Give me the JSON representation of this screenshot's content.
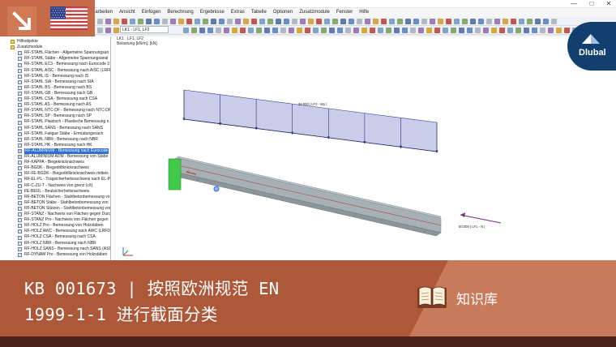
{
  "menu": {
    "items": [
      "Bearbeiten",
      "Ansicht",
      "Einfügen",
      "Berechnung",
      "Ergebnisse",
      "Extras",
      "Tabelle",
      "Optionen",
      "Zusatzmodule",
      "Fenster",
      "Hilfe"
    ]
  },
  "toolbar": {
    "loadcase_combo": "LK1 - LF1, LF2"
  },
  "workspace": {
    "label_case": "LK1 : LF1, LF2",
    "label_load": "Belastung [kN/m], [kN]",
    "load_label_top": "36.000 | LF2 - Wy |",
    "load_label_side": "50.000 | LF1 - N |"
  },
  "navigator": {
    "items": [
      {
        "label": "Hilfsobjekte",
        "icon": "folder-icon",
        "indent": 0
      },
      {
        "label": "Zusatzmodule",
        "icon": "folder-icon",
        "indent": 0
      },
      {
        "label": "RF-STAHL Flächen - Allgemeine Spannungsan",
        "icon": "module-icon",
        "indent": 1
      },
      {
        "label": "RF-STAHL Stäbe - Allgemeine Spannungsanal",
        "icon": "module-icon",
        "indent": 1
      },
      {
        "label": "RF-STAHL EC3 - Bemessung nach Eurocode 3",
        "icon": "module-icon",
        "indent": 1
      },
      {
        "label": "RF-STAHL AISC - Bemessung nach AISC (LRFD",
        "icon": "module-icon",
        "indent": 1
      },
      {
        "label": "RF-STAHL IS - Bemessung nach IS",
        "icon": "module-icon",
        "indent": 1
      },
      {
        "label": "RF-STAHL SIA - Bemessung nach SIA",
        "icon": "module-icon",
        "indent": 1
      },
      {
        "label": "RF-STAHL BS - Bemessung nach BS",
        "icon": "module-icon",
        "indent": 1
      },
      {
        "label": "RF-STAHL GB - Bemessung nach GB",
        "icon": "module-icon",
        "indent": 1
      },
      {
        "label": "RF-STAHL CSA - Bemessung nach CSA",
        "icon": "module-icon",
        "indent": 1
      },
      {
        "label": "RF-STAHL AS - Bemessung nach AS",
        "icon": "module-icon",
        "indent": 1
      },
      {
        "label": "RF-STAHL NTC-DF - Bemessung nach NTC-DF",
        "icon": "module-icon",
        "indent": 1
      },
      {
        "label": "RF-STAHL SP - Bemessung nach SP",
        "icon": "module-icon",
        "indent": 1
      },
      {
        "label": "RF-STAHL Plastisch - Plastische Bemessung n",
        "icon": "module-icon",
        "indent": 1
      },
      {
        "label": "RF-STAHL SANS - Bemessung nach SANS",
        "icon": "module-icon",
        "indent": 1
      },
      {
        "label": "RF-STAHL Fatigue Stäbe - Ermüdungsnach",
        "icon": "module-icon",
        "indent": 1
      },
      {
        "label": "RF-STAHL NBR - Bemessung nach NBR",
        "icon": "module-icon",
        "indent": 1
      },
      {
        "label": "RF-STAHL HK - Bemessung nach HK",
        "icon": "module-icon",
        "indent": 1
      },
      {
        "label": "RF-ALUMINIUM - Bemessung nach Eurocode",
        "icon": "aluminium-icon",
        "indent": 1,
        "selected": true
      },
      {
        "label": "RF-ALUMINIUM ADM - Bemessung von Stäbe",
        "icon": "aluminium-icon",
        "indent": 1
      },
      {
        "label": "RF-KAPPA - Biegeknicknachweis",
        "icon": "module-icon",
        "indent": 1
      },
      {
        "label": "RF-BGDK - Biegedrillknicknachweis",
        "icon": "module-icon",
        "indent": 1
      },
      {
        "label": "RF-FE-BGDK - Biegedrillknicknachweis mittels",
        "icon": "module-icon",
        "indent": 1
      },
      {
        "label": "RF-EL-PL - Tragsicherheitsnachweis nach EL-P",
        "icon": "module-icon",
        "indent": 1
      },
      {
        "label": "RF-C-ZU-T - Nachweis von grenz (c/t)",
        "icon": "module-icon",
        "indent": 1
      },
      {
        "label": "FE-BEUL - Beulsicherheitsnachweis",
        "icon": "module-icon",
        "indent": 1
      },
      {
        "label": "RF-BETON Flächen - Stahlbetonbemessung vo",
        "icon": "module-icon",
        "indent": 1
      },
      {
        "label": "RF-BETON Stäbe - Stahlbetonbemessung von",
        "icon": "module-icon",
        "indent": 1
      },
      {
        "label": "RF-BETON Stützen - Stahlbetonbemessung von",
        "icon": "module-icon",
        "indent": 1
      },
      {
        "label": "RF-STANZ - Nachweis von Flächen gegen Durc",
        "icon": "module-icon",
        "indent": 1
      },
      {
        "label": "RF-STANZ Pro - Nachweis von Flächen gegen",
        "icon": "module-icon",
        "indent": 1
      },
      {
        "label": "RF-HOLZ Pro - Bemessung von Holzstäben",
        "icon": "module-icon",
        "indent": 1
      },
      {
        "label": "RF-HOLZ AWC - Bemessung nach AWC (LRFD",
        "icon": "module-icon",
        "indent": 1
      },
      {
        "label": "RF-HOLZ CSA - Bemessung nach CSA",
        "icon": "module-icon",
        "indent": 1
      },
      {
        "label": "RF-HOLZ NBR - Bemessung nach NBR",
        "icon": "module-icon",
        "indent": 1
      },
      {
        "label": "RF-HOLZ SANS - Bemessung nach SANS (ASD",
        "icon": "module-icon",
        "indent": 1
      },
      {
        "label": "RF-DYNAM Pro - Bemessung von Holzstäben",
        "icon": "module-icon",
        "indent": 1
      }
    ]
  },
  "logo": {
    "text": "Dlubal"
  },
  "banner": {
    "title_line1": "KB 001673 | 按照欧洲规范 EN",
    "title_line2": "1999-1-1 进行截面分类",
    "category": "知识库"
  },
  "colors": {
    "banner_dark": "#ad5939",
    "banner_light": "#c97a5a",
    "badge": "#c66b4a",
    "logo_navy": "#11406f",
    "load_fill": "#c9cdea",
    "beam": "#9aa3a8",
    "support": "#43c94a",
    "footer": "#4a2418"
  }
}
